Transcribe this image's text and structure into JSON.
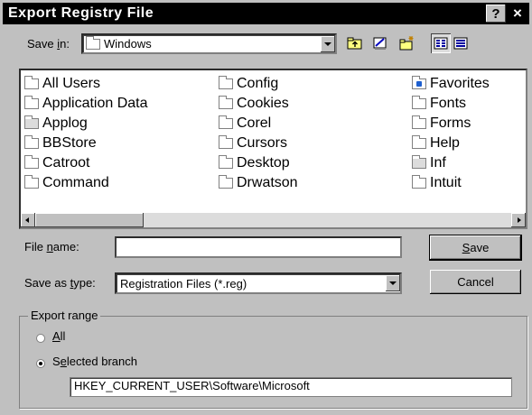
{
  "window": {
    "title": "Export Registry File",
    "help_label": "?",
    "close_label": "×"
  },
  "save_in": {
    "label_pre": "Save ",
    "label_accel": "i",
    "label_post": "n:",
    "value": "Windows"
  },
  "toolbar": {
    "icons": [
      "up-folder-icon",
      "desktop-icon",
      "new-folder-icon",
      "list-view-icon",
      "details-view-icon"
    ]
  },
  "files": {
    "col1": [
      "All Users",
      "Application Data",
      "Applog",
      "BBStore",
      "Catroot",
      "Command"
    ],
    "col2": [
      "Config",
      "Cookies",
      "Corel",
      "Cursors",
      "Desktop",
      "Drwatson"
    ],
    "col3": [
      "Favorites",
      "Fonts",
      "Forms",
      "Help",
      "Inf",
      "Intuit"
    ]
  },
  "file_name": {
    "label_pre": "File ",
    "label_accel": "n",
    "label_post": "ame:",
    "value": ""
  },
  "save_as_type": {
    "label_pre": "Save as ",
    "label_accel": "t",
    "label_post": "ype:",
    "value": "Registration Files (*.reg)"
  },
  "buttons": {
    "save_accel": "S",
    "save_rest": "ave",
    "cancel": "Cancel"
  },
  "export_range": {
    "title": "Export range",
    "all_accel": "A",
    "all_rest": "ll",
    "selected_pre": "S",
    "selected_accel": "e",
    "selected_post": "lected branch",
    "branch_value": "HKEY_CURRENT_USER\\Software\\Microsoft",
    "selected": "selected_branch"
  }
}
